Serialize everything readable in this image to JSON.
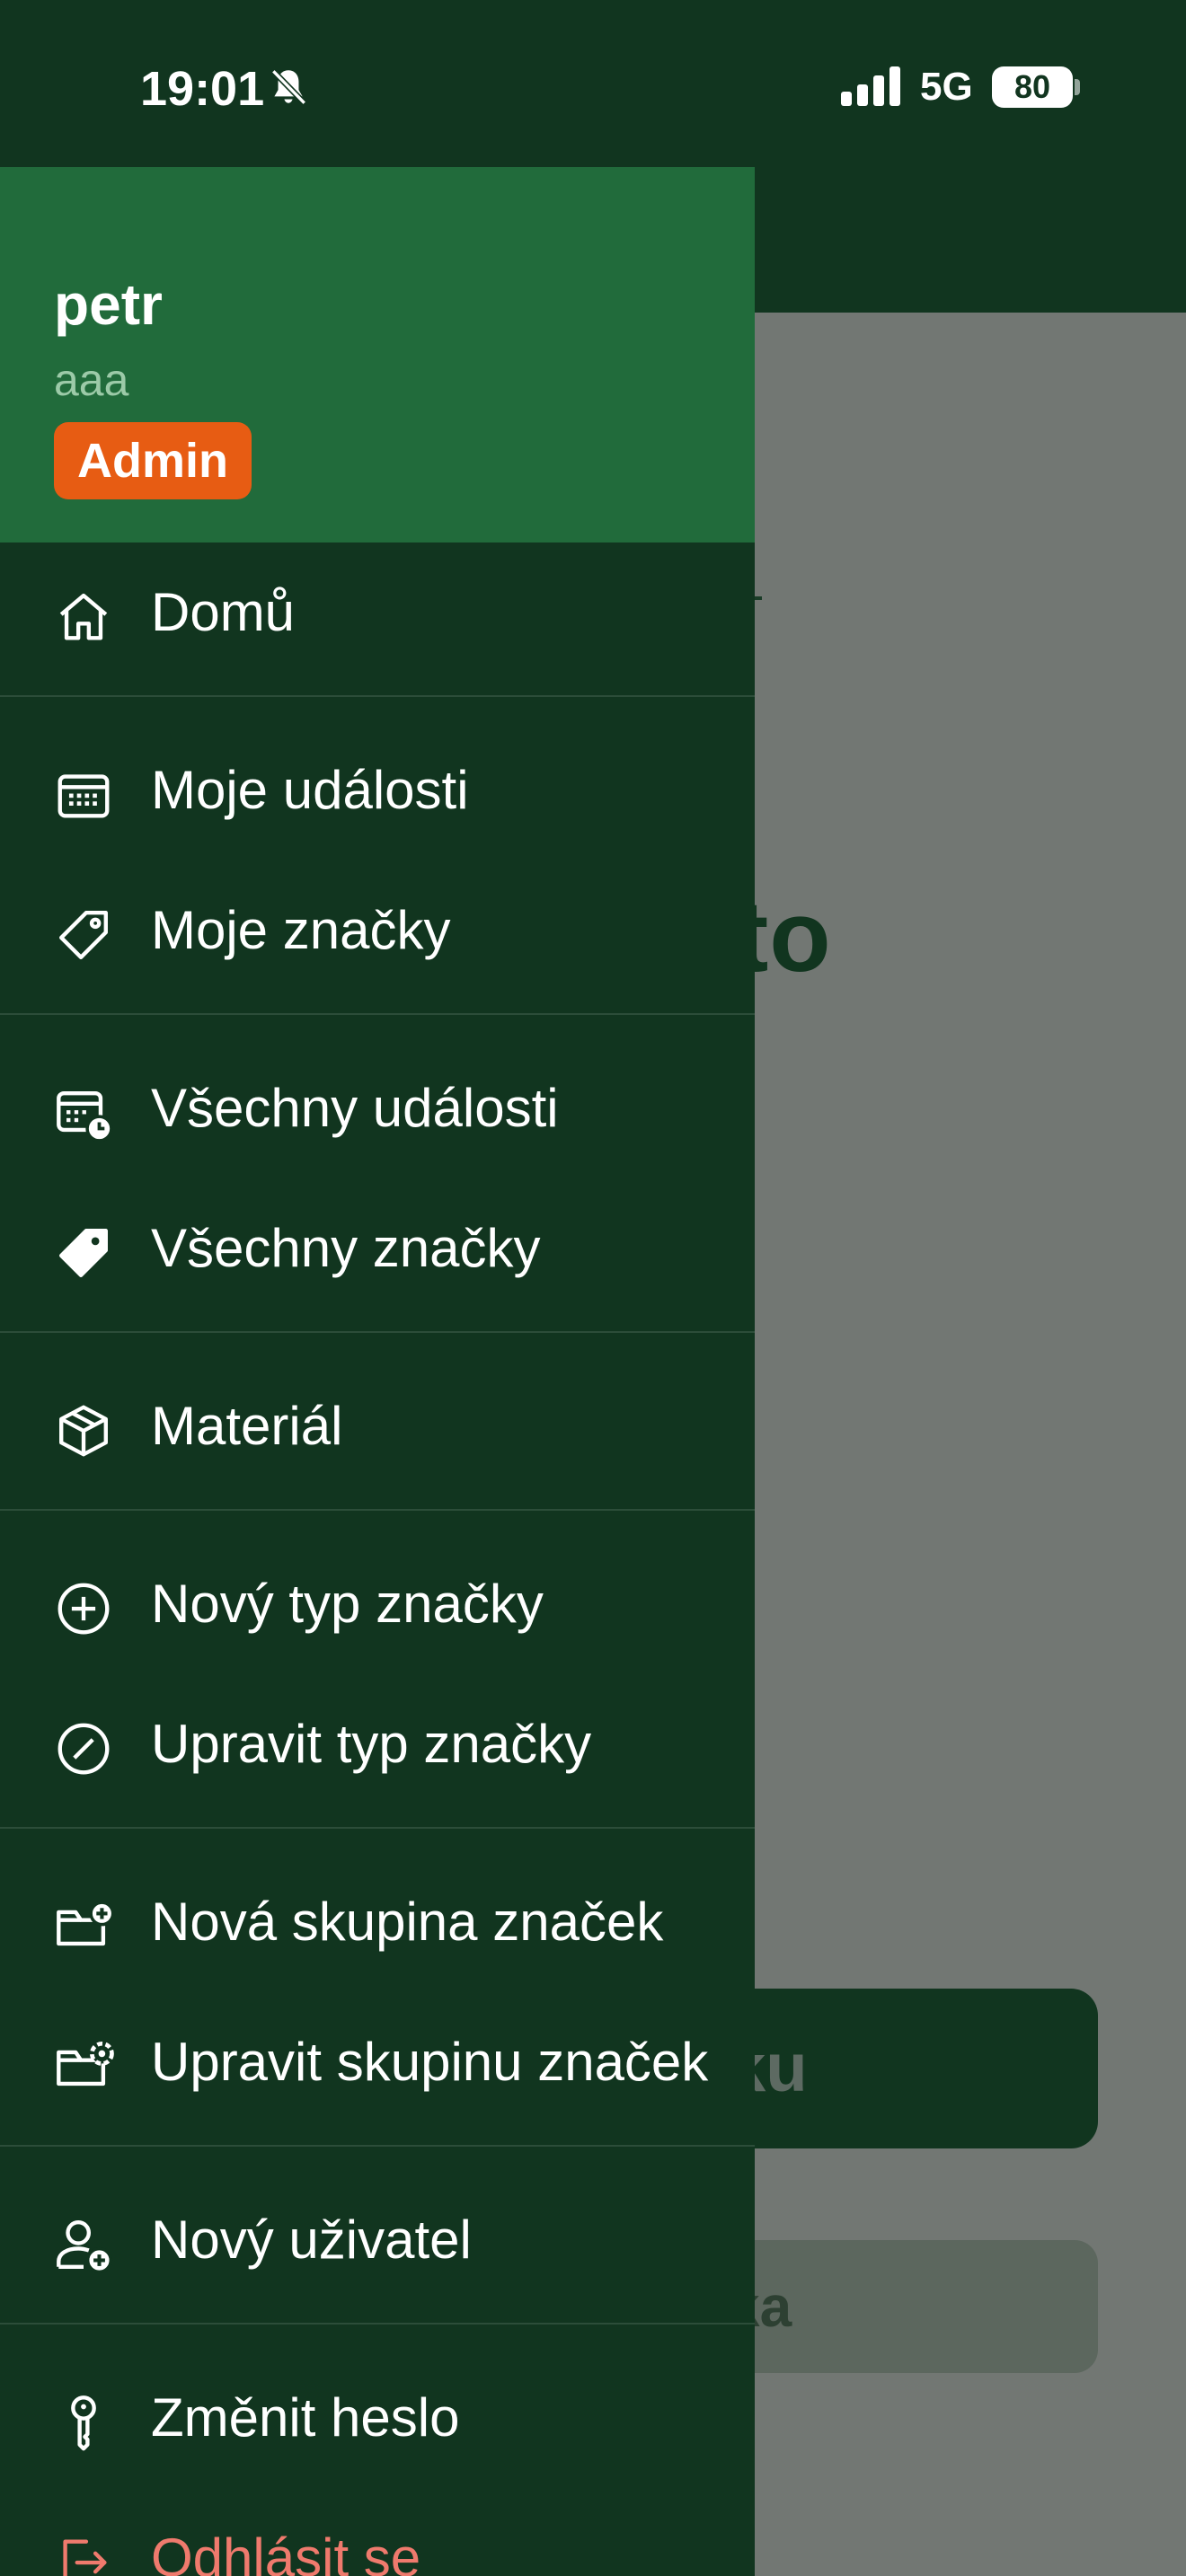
{
  "status": {
    "time": "19:01",
    "network": "5G",
    "battery": "80"
  },
  "background": {
    "title_fragment": "to",
    "primary_button_fragment": "ku",
    "secondary_button_fragment": "ka"
  },
  "drawer": {
    "user": {
      "name": "petr",
      "subtitle": "aaa",
      "role": "Admin"
    },
    "items": [
      {
        "label": "Domů",
        "icon": "home-icon"
      },
      {
        "label": "Moje události",
        "icon": "calendar-icon"
      },
      {
        "label": "Moje značky",
        "icon": "tag-icon"
      },
      {
        "label": "Všechny události",
        "icon": "calendar-clock-icon"
      },
      {
        "label": "Všechny značky",
        "icon": "tag-filled-icon"
      },
      {
        "label": "Materiál",
        "icon": "box-icon"
      },
      {
        "label": "Nový typ značky",
        "icon": "plus-circle-icon"
      },
      {
        "label": "Upravit typ značky",
        "icon": "edit-circle-icon"
      },
      {
        "label": "Nová skupina značek",
        "icon": "folder-plus-icon"
      },
      {
        "label": "Upravit skupinu značek",
        "icon": "folder-gear-icon"
      },
      {
        "label": "Nový uživatel",
        "icon": "user-plus-icon"
      },
      {
        "label": "Změnit heslo",
        "icon": "key-icon"
      },
      {
        "label": "Odhlásit se",
        "icon": "logout-icon"
      }
    ]
  },
  "colors": {
    "drawer_bg": "#11351f",
    "header_bg": "#216b3b",
    "badge": "#e75c13",
    "danger": "#ef7a6d"
  }
}
